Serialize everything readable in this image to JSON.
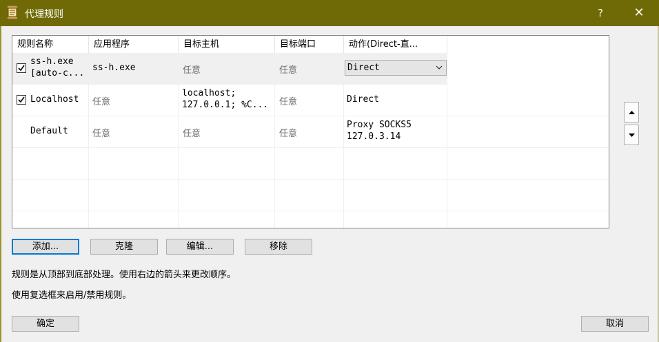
{
  "window": {
    "title": "代理规则",
    "help_glyph": "?",
    "close_glyph": "✕"
  },
  "columns": [
    "规则名称",
    "应用程序",
    "目标主机",
    "目标端口",
    "动作(Direct-直..."
  ],
  "rules": [
    {
      "checked": true,
      "name": [
        "ss-h.exe",
        "[auto-c..."
      ],
      "app": "ss-h.exe",
      "host": "任意",
      "port": "任意",
      "action": "Direct"
    },
    {
      "checked": true,
      "name": "Localhost",
      "app": "任意",
      "host": [
        "localhost;",
        "127.0.0.1; %C..."
      ],
      "port": "任意",
      "action": "Direct"
    },
    {
      "checked": false,
      "name": "Default",
      "app": "任意",
      "host": "任意",
      "port": "任意",
      "action": [
        "Proxy SOCKS5",
        "127.0.3.14"
      ]
    }
  ],
  "buttons": {
    "add": "添加...",
    "clone": "克隆",
    "edit": "编辑...",
    "remove": "移除",
    "ok": "确定",
    "cancel": "取消"
  },
  "info": {
    "line1": "规则是从顶部到底部处理。使用右边的箭头来更改顺序。",
    "line2": "使用复选框来启用/禁用规则。"
  },
  "icons": {
    "title": "proxifier-scroll-icon",
    "move_up": "triangle-up-icon",
    "move_down": "triangle-down-icon",
    "combo": "chevron-down-icon",
    "check": "checkmark-icon"
  },
  "colors": {
    "titlebar": "#6f6a06",
    "default_button_border": "#0078d7"
  }
}
